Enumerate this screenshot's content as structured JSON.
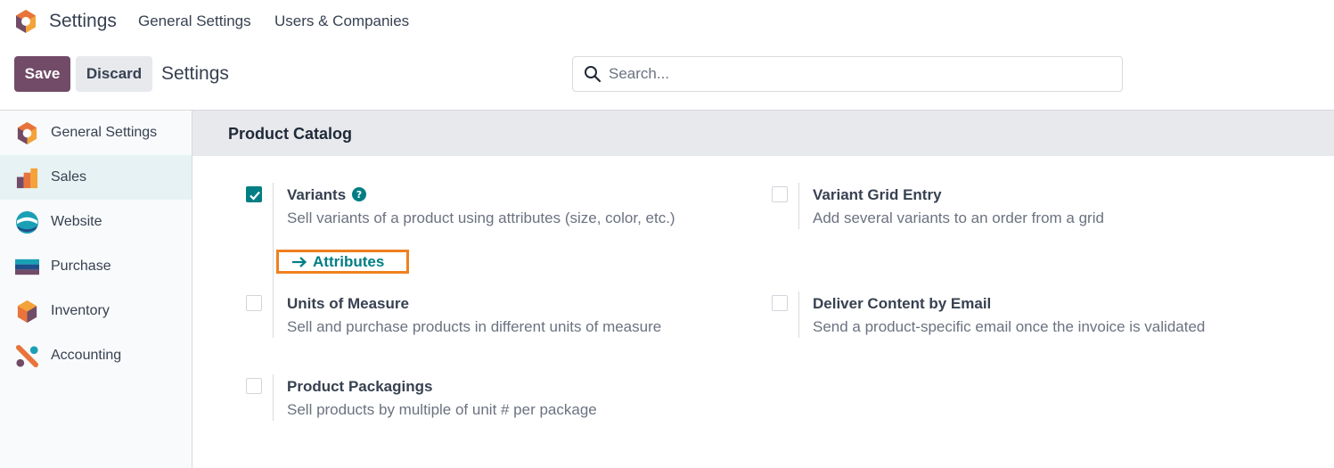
{
  "navbar": {
    "app_name": "Settings",
    "links": [
      "General Settings",
      "Users & Companies"
    ]
  },
  "control_panel": {
    "save_label": "Save",
    "discard_label": "Discard",
    "title": "Settings",
    "search_placeholder": "Search..."
  },
  "sidebar": {
    "items": [
      {
        "label": "General Settings",
        "icon": "settings-hex-icon",
        "active": false
      },
      {
        "label": "Sales",
        "icon": "sales-bars-icon",
        "active": true
      },
      {
        "label": "Website",
        "icon": "website-globe-icon",
        "active": false
      },
      {
        "label": "Purchase",
        "icon": "purchase-card-icon",
        "active": false
      },
      {
        "label": "Inventory",
        "icon": "inventory-box-icon",
        "active": false
      },
      {
        "label": "Accounting",
        "icon": "accounting-percent-icon",
        "active": false
      }
    ]
  },
  "section": {
    "title": "Product Catalog",
    "settings": [
      {
        "key": "variants",
        "title": "Variants",
        "description": "Sell variants of a product using attributes (size, color, etc.)",
        "checked": true,
        "help": true,
        "link": "Attributes"
      },
      {
        "key": "variant_grid",
        "title": "Variant Grid Entry",
        "description": "Add several variants to an order from a grid",
        "checked": false
      },
      {
        "key": "uom",
        "title": "Units of Measure",
        "description": "Sell and purchase products in different units of measure",
        "checked": false
      },
      {
        "key": "deliver_email",
        "title": "Deliver Content by Email",
        "description": "Send a product-specific email once the invoice is validated",
        "checked": false
      },
      {
        "key": "packagings",
        "title": "Product Packagings",
        "description": "Sell products by multiple of unit # per package",
        "checked": false
      }
    ]
  },
  "colors": {
    "brand": "#714b67",
    "accent": "#017e84",
    "highlight": "#f08020"
  }
}
